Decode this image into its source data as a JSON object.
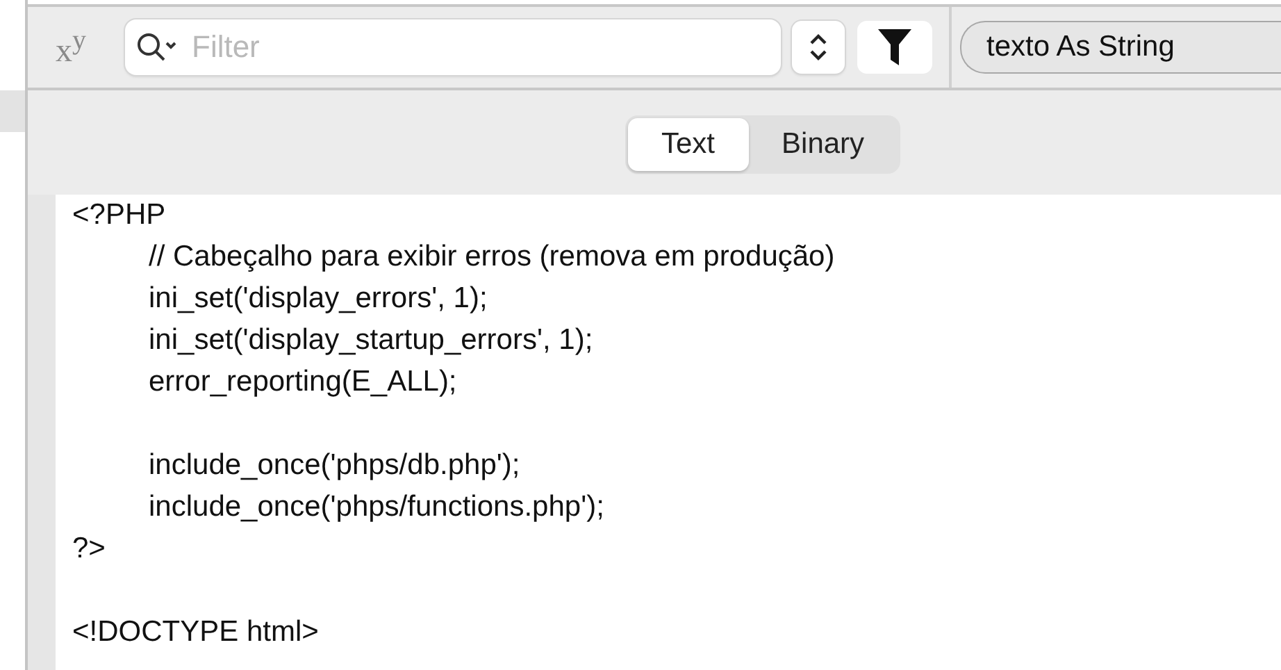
{
  "toolbar": {
    "superscript_label": "x",
    "superscript_raised": "y",
    "filter": {
      "placeholder": "Filter"
    },
    "type_popup": "texto As String"
  },
  "view_tabs": [
    {
      "label": "Text",
      "selected": true
    },
    {
      "label": "Binary",
      "selected": false
    }
  ],
  "code": "<?PHP\n\t// Cabeçalho para exibir erros (remova em produção)\n\tini_set('display_errors', 1);\n\tini_set('display_startup_errors', 1);\n\terror_reporting(E_ALL);\n\n\tinclude_once('phps/db.php');\n\tinclude_once('phps/functions.php');\n?>\n\n<!DOCTYPE html>"
}
